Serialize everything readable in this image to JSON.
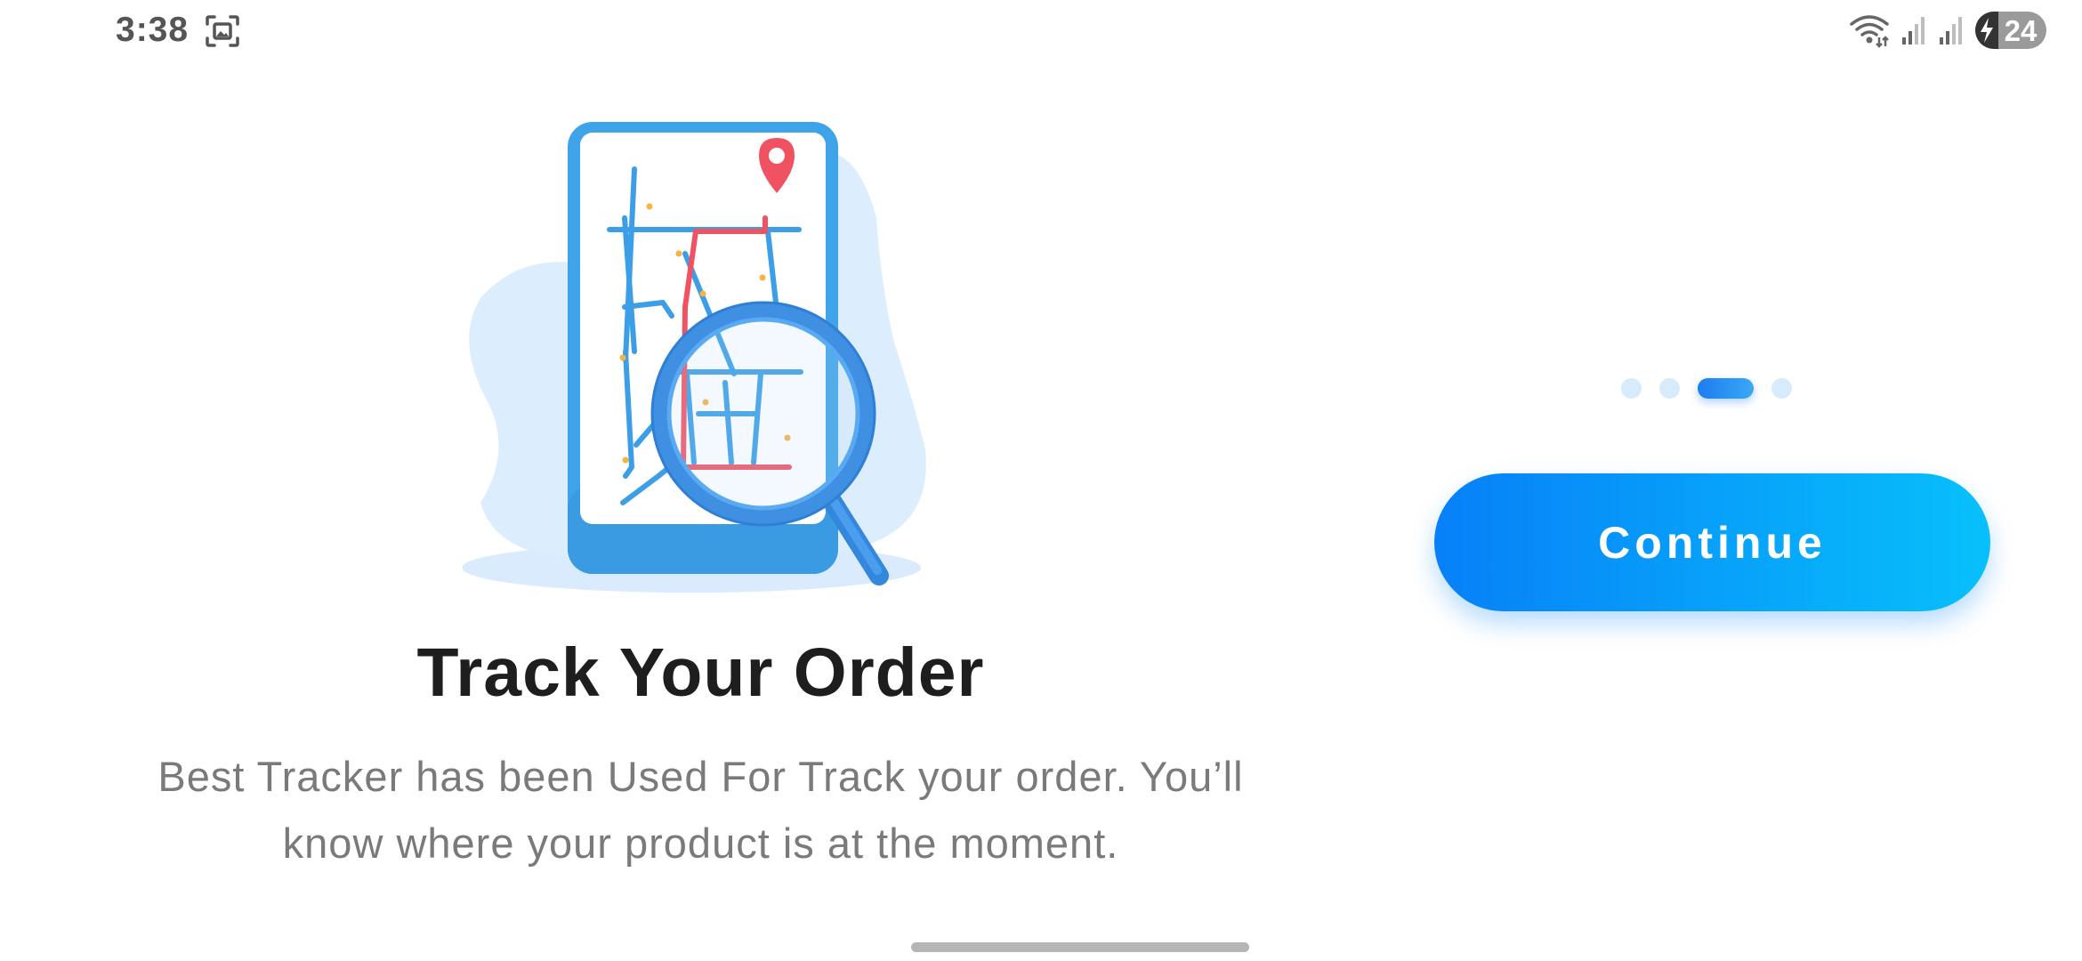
{
  "status_bar": {
    "time": "3:38",
    "battery_level": "24",
    "icons": [
      "screenshot-icon",
      "wifi-icon",
      "cell-signal-icon",
      "cell-signal-icon",
      "battery-charging-icon"
    ]
  },
  "onboarding": {
    "illustration_icon": "phone-map-magnifier-illustration",
    "title": "Track Your Order",
    "description": "Best Tracker has been Used For Track your order. You’ll know where your product is at the moment.",
    "page_count": 4,
    "active_page": 3,
    "continue_label": "Continue"
  },
  "colors": {
    "accent_start": "#0780f8",
    "accent_end": "#07c0fb",
    "title": "#1e1e1e",
    "description": "#7a7a7a",
    "pin_red": "#f0505f"
  }
}
